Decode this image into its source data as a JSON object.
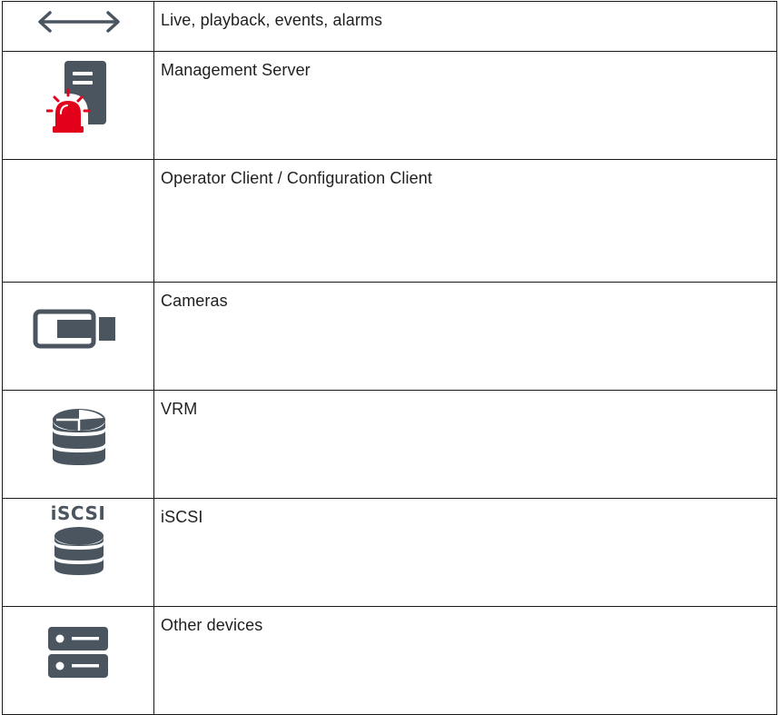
{
  "rows": [
    {
      "icon": "double-arrow-icon",
      "label": "Live, playback, events, alarms"
    },
    {
      "icon": "management-server-alarm-icon",
      "label": "Management Server"
    },
    {
      "icon": "",
      "label": "Operator Client / Configuration Client"
    },
    {
      "icon": "camera-icon",
      "label": "Cameras"
    },
    {
      "icon": "vrm-storage-icon",
      "label": "VRM"
    },
    {
      "icon": "iscsi-storage-icon",
      "label": "iSCSI",
      "icon_text": "iSCSI"
    },
    {
      "icon": "other-devices-icon",
      "label": "Other devices"
    }
  ],
  "colors": {
    "icon_gray": "#4a5560",
    "alarm_red": "#e2001a",
    "border": "#1a1a1a",
    "text": "#1f1f1f"
  }
}
